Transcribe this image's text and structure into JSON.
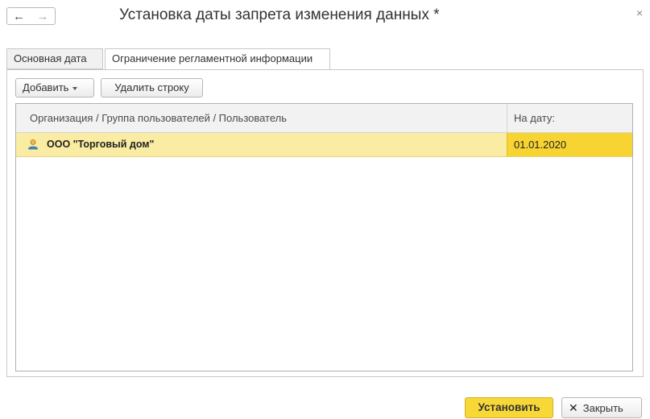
{
  "window": {
    "title": "Установка даты запрета изменения данных *",
    "close_glyph": "×"
  },
  "nav": {
    "back_icon": "arrow-left-icon",
    "back_glyph": "←",
    "forward_icon": "arrow-right-icon",
    "forward_glyph": "→"
  },
  "tabs": [
    {
      "label": "Основная дата",
      "active": false
    },
    {
      "label": "Ограничение регламентной информации",
      "active": true
    }
  ],
  "toolbar": {
    "add_label": "Добавить",
    "delete_label": "Удалить строку"
  },
  "table": {
    "columns": [
      "Организация / Группа пользователей / Пользователь",
      "На дату:"
    ],
    "rows": [
      {
        "icon": "user-icon",
        "name": "ООО \"Торговый дом\"",
        "date": "01.01.2020"
      }
    ]
  },
  "footer": {
    "set_label": "Установить",
    "close_label": "Закрыть",
    "close_glyph": "✕"
  },
  "colors": {
    "selected_row": "#fbeca3",
    "selected_cell": "#f7d432",
    "primary_button": "#f7d837"
  }
}
